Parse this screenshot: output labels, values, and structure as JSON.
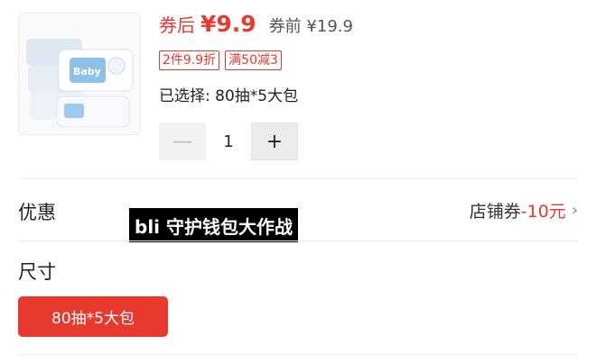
{
  "product": {
    "image_alt_icon": "wipes-package-image",
    "package_text": "Baby"
  },
  "price": {
    "after_label": "券后",
    "after_value": "¥9.9",
    "before_label": "券前",
    "before_value": "¥19.9"
  },
  "tags": [
    "2件9.9折",
    "满50减3"
  ],
  "selection": {
    "text": "已选择: 80抽*5大包"
  },
  "quantity": {
    "minus_icon": "minus-icon",
    "value": "1",
    "plus_icon": "plus-icon"
  },
  "discount": {
    "title": "优惠",
    "store_coupon_label": "店铺券",
    "coupon_amount": "-10元",
    "chevron_icon": "chevron-right-icon"
  },
  "overlay": {
    "text": "bli 守护钱包大作战"
  },
  "size": {
    "title": "尺寸",
    "options": [
      "80抽*5大包"
    ]
  },
  "colors": {
    "accent": "#e8392f",
    "divider": "#ededed"
  }
}
